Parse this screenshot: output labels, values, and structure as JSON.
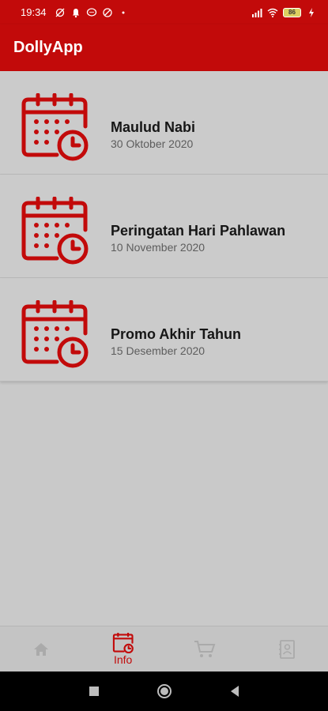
{
  "status_bar": {
    "time": "19:34",
    "battery_level": "86"
  },
  "app_bar": {
    "title": "DollyApp"
  },
  "events": [
    {
      "title": "Maulud Nabi",
      "date": "30 Oktober 2020"
    },
    {
      "title": "Peringatan Hari Pahlawan",
      "date": "10 November 2020"
    },
    {
      "title": "Promo Akhir Tahun",
      "date": "15 Desember 2020"
    }
  ],
  "bottom_nav": {
    "items": [
      {
        "icon": "home-icon",
        "label": ""
      },
      {
        "icon": "calendar-clock-icon",
        "label": "Info"
      },
      {
        "icon": "cart-icon",
        "label": ""
      },
      {
        "icon": "contacts-icon",
        "label": ""
      }
    ],
    "active_index": 1
  },
  "colors": {
    "brand": "#c20a0a",
    "background": "#c9c9c9",
    "inactive": "#aaaaaa"
  }
}
